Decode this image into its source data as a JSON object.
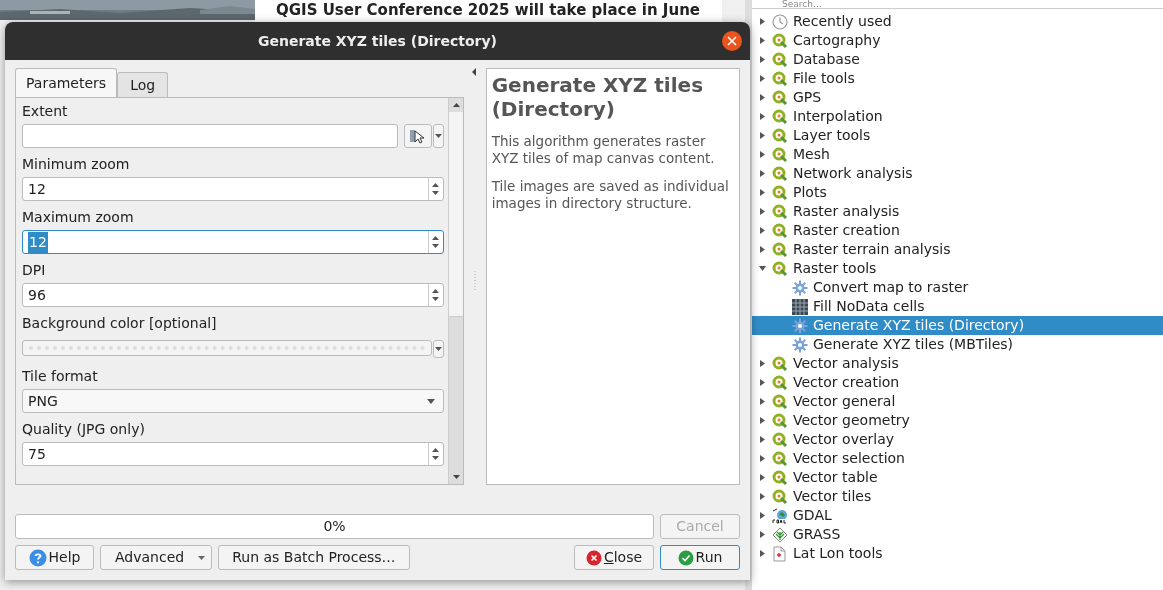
{
  "background": {
    "headline": "QGIS User Conference 2025 will take place in June"
  },
  "dialog": {
    "title": "Generate XYZ tiles (Directory)",
    "tabs": [
      {
        "label": "Parameters",
        "selected": true
      },
      {
        "label": "Log",
        "selected": false
      }
    ],
    "parameters": [
      {
        "label": "Extent",
        "kind": "extent",
        "focused": false
      },
      {
        "label": "Minimum zoom",
        "kind": "spin",
        "value": "12",
        "focused": false
      },
      {
        "label": "Maximum zoom",
        "kind": "spin",
        "value": "12",
        "focused": true
      },
      {
        "label": "DPI",
        "kind": "spin",
        "value": "96",
        "focused": false
      },
      {
        "label": "Background color [optional]",
        "kind": "color",
        "focused": false
      },
      {
        "label": "Tile format",
        "kind": "combo",
        "value": "PNG",
        "focused": false
      },
      {
        "label": "Quality (JPG only)",
        "kind": "spin",
        "value": "75",
        "focused": false
      }
    ],
    "description": {
      "title": "Generate XYZ tiles (Directory)",
      "paragraphs": [
        "This algorithm generates raster XYZ tiles of map canvas content.",
        "Tile images are saved as individual images in directory structure."
      ]
    },
    "progress": {
      "level": 0,
      "reading": "0%"
    },
    "cancel": {
      "label": "Cancel",
      "disabled": true
    },
    "buttons": [
      {
        "label": "Help",
        "kind": "help"
      },
      {
        "label": "Advanced",
        "kind": "menu"
      },
      {
        "label": "Run as Batch Process…",
        "kind": "plain"
      },
      {
        "label": "Close",
        "kind": "close"
      },
      {
        "label": "Run",
        "kind": "run"
      }
    ]
  },
  "toolbox": {
    "search": {
      "placeholder": "Search…"
    },
    "items": [
      {
        "label": "Recently used",
        "kind": "clock",
        "expanded": false,
        "selected": false
      },
      {
        "label": "Cartography",
        "kind": "qgis",
        "expanded": false,
        "selected": false
      },
      {
        "label": "Database",
        "kind": "qgis",
        "expanded": false,
        "selected": false
      },
      {
        "label": "File tools",
        "kind": "qgis",
        "expanded": false,
        "selected": false
      },
      {
        "label": "GPS",
        "kind": "qgis",
        "expanded": false,
        "selected": false
      },
      {
        "label": "Interpolation",
        "kind": "qgis",
        "expanded": false,
        "selected": false
      },
      {
        "label": "Layer tools",
        "kind": "qgis",
        "expanded": false,
        "selected": false
      },
      {
        "label": "Mesh",
        "kind": "qgis",
        "expanded": false,
        "selected": false
      },
      {
        "label": "Network analysis",
        "kind": "qgis",
        "expanded": false,
        "selected": false
      },
      {
        "label": "Plots",
        "kind": "qgis",
        "expanded": false,
        "selected": false
      },
      {
        "label": "Raster analysis",
        "kind": "qgis",
        "expanded": false,
        "selected": false
      },
      {
        "label": "Raster creation",
        "kind": "qgis",
        "expanded": false,
        "selected": false
      },
      {
        "label": "Raster terrain analysis",
        "kind": "qgis",
        "expanded": false,
        "selected": false
      },
      {
        "label": "Raster tools",
        "kind": "qgis",
        "expanded": true,
        "selected": false,
        "children": [
          {
            "label": "Convert map to raster",
            "kind": "gear",
            "selected": false
          },
          {
            "label": "Fill NoData cells",
            "kind": "grid",
            "selected": false
          },
          {
            "label": "Generate XYZ tiles (Directory)",
            "kind": "gear",
            "selected": true
          },
          {
            "label": "Generate XYZ tiles (MBTiles)",
            "kind": "gear",
            "selected": false
          }
        ]
      },
      {
        "label": "Vector analysis",
        "kind": "qgis",
        "expanded": false,
        "selected": false
      },
      {
        "label": "Vector creation",
        "kind": "qgis",
        "expanded": false,
        "selected": false
      },
      {
        "label": "Vector general",
        "kind": "qgis",
        "expanded": false,
        "selected": false
      },
      {
        "label": "Vector geometry",
        "kind": "qgis",
        "expanded": false,
        "selected": false
      },
      {
        "label": "Vector overlay",
        "kind": "qgis",
        "expanded": false,
        "selected": false
      },
      {
        "label": "Vector selection",
        "kind": "qgis",
        "expanded": false,
        "selected": false
      },
      {
        "label": "Vector table",
        "kind": "qgis",
        "expanded": false,
        "selected": false
      },
      {
        "label": "Vector tiles",
        "kind": "qgis",
        "expanded": false,
        "selected": false
      },
      {
        "label": "GDAL",
        "kind": "gdal",
        "expanded": false,
        "selected": false
      },
      {
        "label": "GRASS",
        "kind": "grass",
        "expanded": false,
        "selected": false
      },
      {
        "label": "Lat Lon tools",
        "kind": "latlon",
        "expanded": false,
        "selected": false
      }
    ]
  }
}
